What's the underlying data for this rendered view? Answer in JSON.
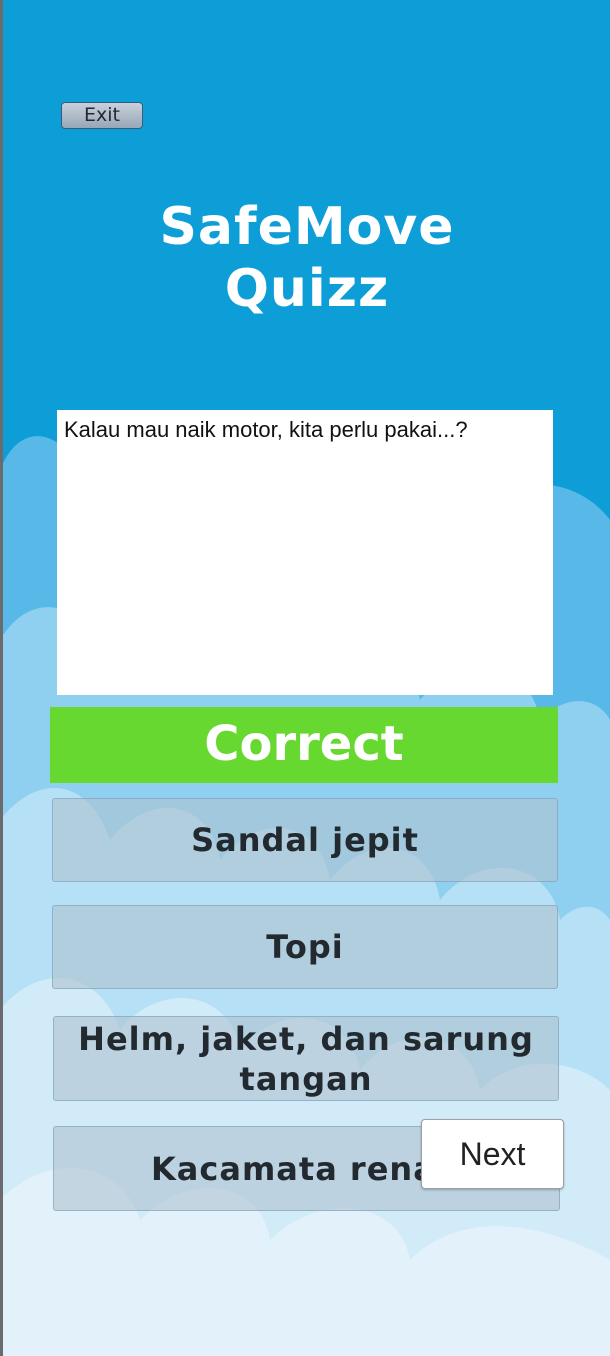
{
  "header": {
    "exit_label": "Exit",
    "title_line1": "SafeMove",
    "title_line2": "Quizz"
  },
  "question": {
    "text": "Kalau mau naik motor, kita perlu pakai...?"
  },
  "result": {
    "label": "Correct",
    "color": "#66d830"
  },
  "answers": [
    {
      "line1": "Sandal jepit"
    },
    {
      "line1": "Topi"
    },
    {
      "line1": "Helm, jaket, dan sarung",
      "line2": "tangan"
    },
    {
      "line1": "Kacamata rena"
    }
  ],
  "controls": {
    "next_label": "Next"
  },
  "colors": {
    "background": "#0e9ed7",
    "cloud": "#dff0f9"
  }
}
